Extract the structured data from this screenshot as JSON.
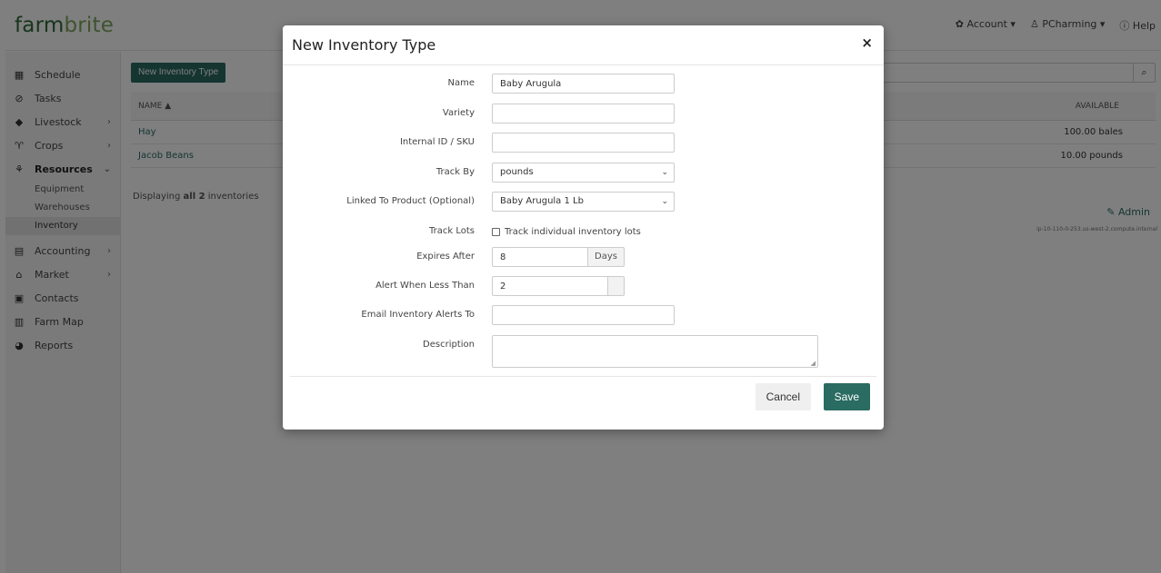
{
  "app": {
    "logo_part1": "farm",
    "logo_part2": "brite",
    "account_label": "Account ▾",
    "user_label": "PCharming ▾",
    "help_label": "Help"
  },
  "sidebar": {
    "items": [
      {
        "label": "Schedule",
        "icon": "calendar-icon"
      },
      {
        "label": "Tasks",
        "icon": "check-circle-icon"
      },
      {
        "label": "Livestock",
        "icon": "livestock-icon"
      },
      {
        "label": "Crops",
        "icon": "sprout-icon"
      },
      {
        "label": "Resources",
        "icon": "resources-icon"
      },
      {
        "label": "Accounting",
        "icon": "calculator-icon"
      },
      {
        "label": "Market",
        "icon": "store-icon"
      },
      {
        "label": "Contacts",
        "icon": "contacts-icon"
      },
      {
        "label": "Farm Map",
        "icon": "map-icon"
      },
      {
        "label": "Reports",
        "icon": "pie-chart-icon"
      }
    ],
    "resources_sub": [
      "Equipment",
      "Warehouses",
      "Inventory"
    ]
  },
  "main": {
    "new_button": "New Inventory Type",
    "table": {
      "col_name": "NAME ▲",
      "col_available": "AVAILABLE",
      "rows": [
        {
          "name": "Hay",
          "available": "100.00 bales"
        },
        {
          "name": "Jacob Beans",
          "available": "10.00 pounds"
        }
      ]
    },
    "display_prefix": "Displaying ",
    "display_bold": "all 2",
    "display_suffix": " inventories",
    "admin_link": "Admin",
    "host": "ip-10-110-0-253.us-west-2.compute.internal"
  },
  "modal": {
    "title": "New Inventory Type",
    "close": "×",
    "fields": {
      "name_label": "Name",
      "name_value": "Baby Arugula",
      "variety_label": "Variety",
      "variety_value": "",
      "sku_label": "Internal ID / SKU",
      "sku_value": "",
      "trackby_label": "Track By",
      "trackby_value": "pounds",
      "linked_label": "Linked To Product (Optional)",
      "linked_value": "Baby Arugula 1 Lb",
      "tracklots_label": "Track Lots",
      "tracklots_text": "Track individual inventory lots",
      "expires_label": "Expires After",
      "expires_value": "8",
      "expires_unit": "Days",
      "alert_label": "Alert When Less Than",
      "alert_value": "2",
      "email_label": "Email Inventory Alerts To",
      "email_value": "",
      "desc_label": "Description"
    },
    "cancel": "Cancel",
    "save": "Save"
  }
}
